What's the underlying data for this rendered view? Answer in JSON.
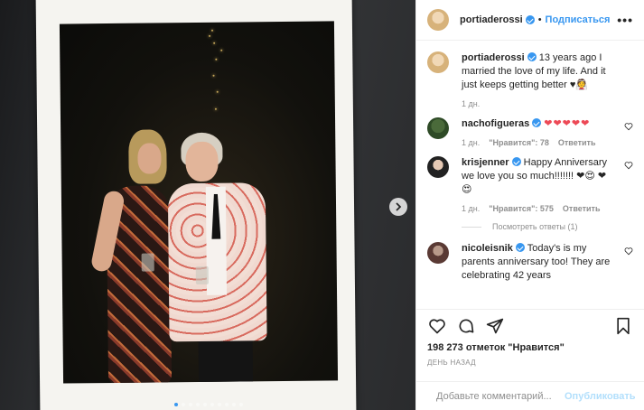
{
  "post": {
    "author": "portiaderossi",
    "follow_label": "Подписаться",
    "dot": "•",
    "more": "•••",
    "next_icon": "chevron-right-icon",
    "carousel": {
      "total": 10,
      "active": 0
    }
  },
  "comments": [
    {
      "user": "portiaderossi",
      "verified": true,
      "text": "13 years ago I married the love of my life. And it just keeps getting better ♥👰",
      "time": "1 дн.",
      "likes": "",
      "reply": "",
      "has_heart": false,
      "avatar": "portia"
    },
    {
      "user": "nachofigueras",
      "verified": true,
      "text": "",
      "hearts": "❤❤❤❤❤",
      "time": "1 дн.",
      "likes": "\"Нравится\": 78",
      "reply": "Ответить",
      "has_heart": true,
      "avatar": "nacho"
    },
    {
      "user": "krisjenner",
      "verified": true,
      "text": "Happy Anniversary we love you so much!!!!!!! ❤😍 ❤😍",
      "time": "1 дн.",
      "likes": "\"Нравится\": 575",
      "reply": "Ответить",
      "has_heart": true,
      "avatar": "kris",
      "view_replies": "Посмотреть ответы (1)"
    },
    {
      "user": "nicoleisnik",
      "verified": true,
      "text": "Today's is my parents anniversary too! They are celebrating 42 years",
      "time": "",
      "likes": "",
      "reply": "",
      "has_heart": true,
      "avatar": "nicole"
    }
  ],
  "actions": {
    "icons": [
      "heart-icon",
      "comment-icon",
      "share-icon",
      "bookmark-icon"
    ]
  },
  "likes_text": "198 273 отметок \"Нравится\"",
  "date_text": "ДЕНЬ НАЗАД",
  "add_comment": {
    "placeholder": "Добавьте комментарий...",
    "post_label": "Опубликовать",
    "emoji_icon": "smiley-icon"
  },
  "colors": {
    "accent": "#3897f0",
    "heart": "#ed4956",
    "muted": "#8e8e8e"
  }
}
